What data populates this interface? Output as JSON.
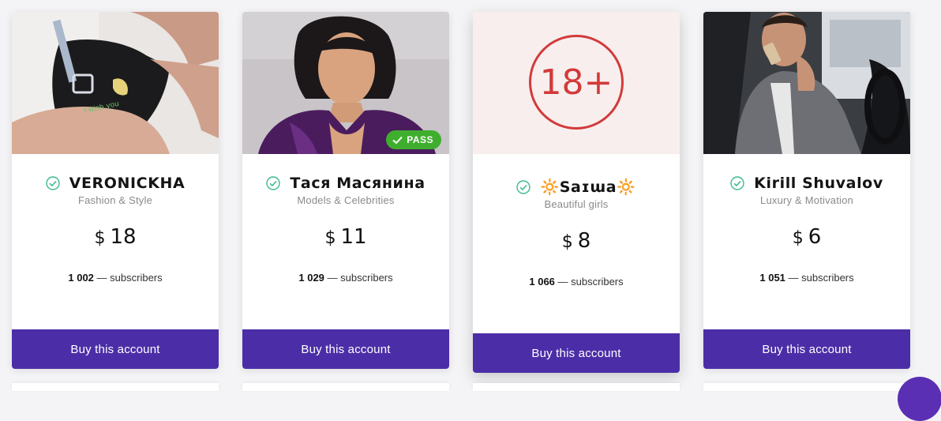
{
  "cards": [
    {
      "name": "VERONICKHA",
      "category": "Fashion & Style",
      "currency": "$",
      "price": "18",
      "subscriber_count": "1 002",
      "subscribers_label": "— subscribers",
      "buy_label": "Buy this account"
    },
    {
      "name": "Тася Масянина",
      "category": "Models & Celebrities",
      "currency": "$",
      "price": "11",
      "subscriber_count": "1 029",
      "subscribers_label": "— subscribers",
      "buy_label": "Buy this account",
      "badge": "PASS"
    },
    {
      "name": "🔆Saɪɯa🔆",
      "category": "Beautiful girls",
      "currency": "$",
      "price": "8",
      "subscriber_count": "1 066",
      "subscribers_label": "— subscribers",
      "buy_label": "Buy this account",
      "age_label": "18+"
    },
    {
      "name": "Kirill Shuvalov",
      "category": "Luxury & Motivation",
      "currency": "$",
      "price": "6",
      "subscriber_count": "1 051",
      "subscribers_label": "— subscribers",
      "buy_label": "Buy this account"
    }
  ],
  "colors": {
    "button": "#4b2ea7",
    "check": "#3dbb8c",
    "pass": "#3fae2e",
    "age": "#d33a3a"
  }
}
